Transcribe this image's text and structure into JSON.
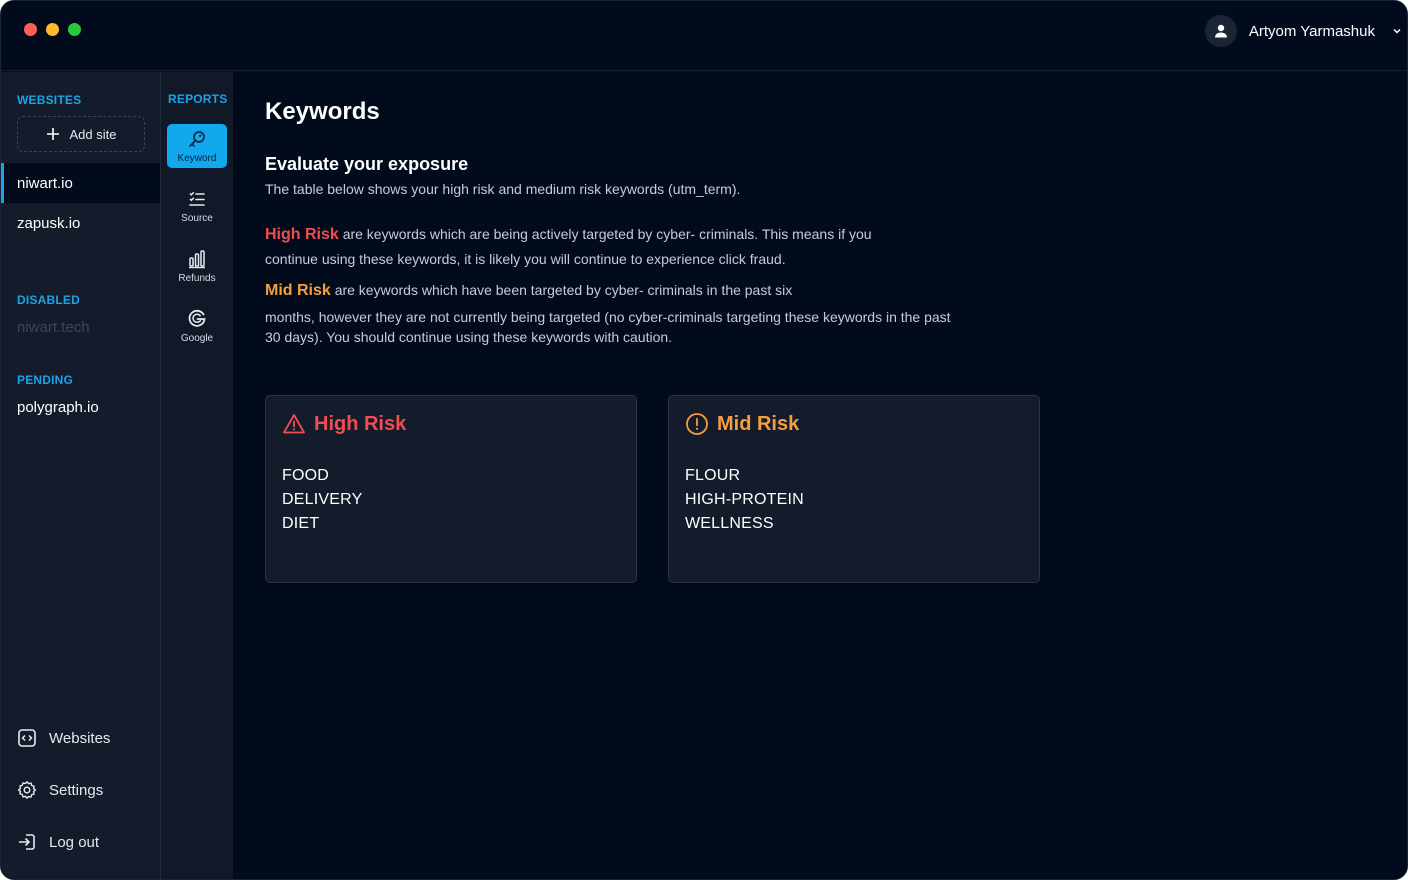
{
  "user": {
    "name": "Artyom Yarmashuk"
  },
  "sidebar": {
    "websites_title": "WEBSITES",
    "add_site_label": "Add site",
    "websites": [
      {
        "label": "niwart.io",
        "active": true
      },
      {
        "label": "zapusk.io",
        "active": false
      }
    ],
    "disabled_title": "DISABLED",
    "disabled": [
      {
        "label": "niwart.tech"
      }
    ],
    "pending_title": "PENDING",
    "pending": [
      {
        "label": "polygraph.io"
      }
    ],
    "bottom": [
      {
        "label": "Websites",
        "icon": "websites-icon"
      },
      {
        "label": "Settings",
        "icon": "gear-icon"
      },
      {
        "label": "Log out",
        "icon": "logout-icon"
      }
    ]
  },
  "reports": {
    "title": "REPORTS",
    "items": [
      {
        "label": "Keyword",
        "icon": "key-icon",
        "active": true
      },
      {
        "label": "Source",
        "icon": "list-icon",
        "active": false
      },
      {
        "label": "Refunds",
        "icon": "bar-chart-icon",
        "active": false
      },
      {
        "label": "Google",
        "icon": "google-icon",
        "active": false
      }
    ]
  },
  "main": {
    "title": "Keywords",
    "subtitle": "Evaluate your exposure",
    "intro": "The table below shows your high risk and medium risk keywords (utm_term).",
    "high_risk": {
      "label": "High Risk",
      "line1": "are keywords which are being actively targeted by cyber- criminals. This means if you",
      "line2": "continue using these keywords, it is likely you will continue to experience click fraud."
    },
    "mid_risk": {
      "label": "Mid Risk",
      "line1": "are keywords which have been targeted by cyber- criminals in the past six",
      "line2": "months, however they are not currently being targeted (no cyber-criminals targeting these keywords in the past",
      "line3": "30 days). You should continue using these keywords with caution."
    },
    "cards": {
      "high": {
        "title": "High Risk",
        "color": "#f04d52",
        "keywords": [
          "FOOD",
          "DELIVERY",
          "DIET"
        ]
      },
      "mid": {
        "title": "Mid Risk",
        "color": "#f59e3c",
        "keywords": [
          "FLOUR",
          "HIGH-PROTEIN",
          "WELLNESS"
        ]
      }
    }
  },
  "colors": {
    "accent": "#1aa3e8",
    "background": "#020b1c",
    "panel": "#141c2b"
  }
}
